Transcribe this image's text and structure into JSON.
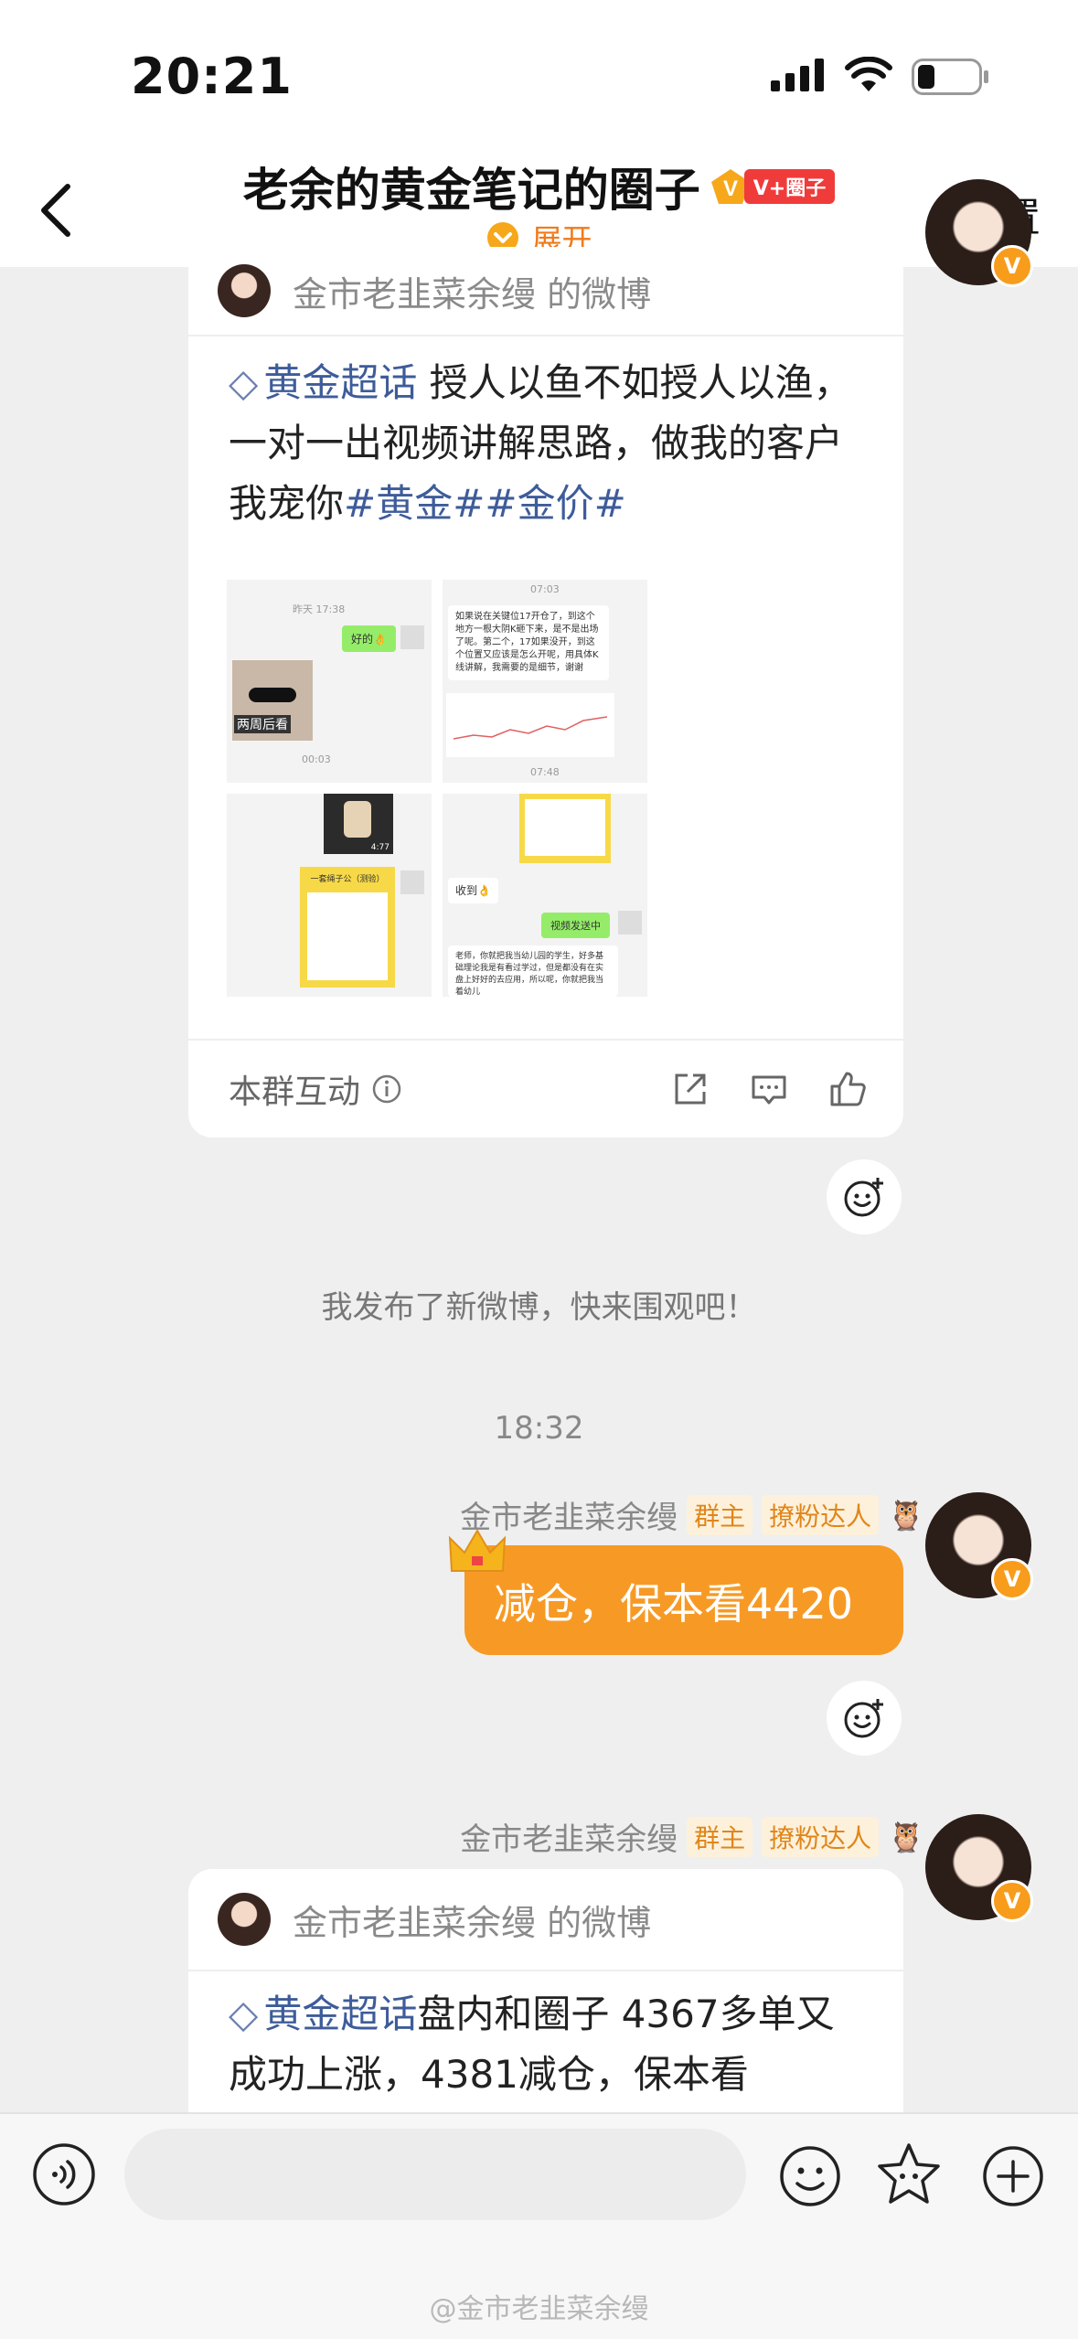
{
  "status": {
    "time": "20:21"
  },
  "header": {
    "title": "老余的黄金笔记的圈子",
    "badge": "V+圈子",
    "expand": "展开",
    "settings": "设置"
  },
  "card1": {
    "source": "金市老韭菜余缦 的微博",
    "topic": "黄金超话",
    "text": " 授人以鱼不如授人以渔，一对一出视频讲解思路，做我的客户我宠你",
    "hashtags": "#黄金##金价#",
    "thumbs": {
      "t1_time": "昨天 17:38",
      "t1_ok": "好的👌",
      "t1_caption": "两周后看",
      "t1_time2": "00:03",
      "t2_time": "07:03",
      "t2_text": "如果说在关键位17开仓了，到这个地方一根大阴K砸下来，是不是出场了呢。第二个，17如果没开，到这个位置又应该是怎么开呢，用具体K线讲解，我需要的是细节，谢谢",
      "t2_time2": "07:48",
      "t3_top": "4:77",
      "t3_card": "一套绳子公（测验）",
      "t4_recv": "收到👌",
      "t4_sending": "视频发送中",
      "t4_text": "老师，你就把我当幼儿园的学生，好多基础理论我是有看过学过，但是都没有在实盘上好好的去应用，所以呢，你就把我当着幼儿"
    },
    "interact_label": "本群互动"
  },
  "system_msg": "我发布了新微博，快来围观吧！",
  "time_sep": "18:32",
  "msg1": {
    "name": "金市老韭菜余缦",
    "tag1": "群主",
    "tag2": "撩粉达人",
    "text": "减仓，保本看4420"
  },
  "msg2": {
    "name": "金市老韭菜余缦",
    "tag1": "群主",
    "tag2": "撩粉达人"
  },
  "card2": {
    "source": "金市老韭菜余缦 的微博",
    "topic": "黄金超话",
    "text": "盘内和圈子 4367多单又成功上涨，4381减仓，保本看"
  },
  "watermark": "@金市老韭菜余缦"
}
